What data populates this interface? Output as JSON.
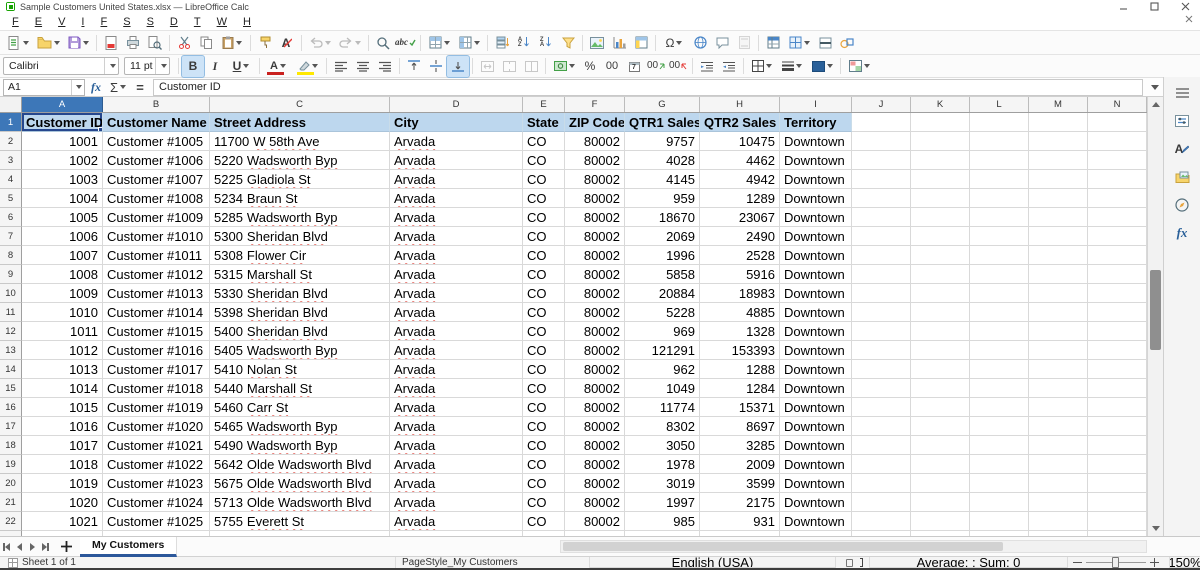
{
  "window": {
    "title": "Sample Customers United States.xlsx — LibreOffice Calc",
    "controls": [
      "minimize",
      "maximize",
      "close"
    ]
  },
  "menu": {
    "items": [
      "File",
      "Edit",
      "View",
      "Insert",
      "Format",
      "Styles",
      "Sheet",
      "Data",
      "Tools",
      "Window",
      "Help"
    ]
  },
  "toolbars": {
    "standard_icons": [
      "new",
      "open",
      "save",
      "export-as-pdf",
      "print",
      "print-preview",
      "cut",
      "copy",
      "paste",
      "clone-formatting",
      "clear-formatting",
      "undo",
      "redo",
      "find-and-replace",
      "spelling",
      "insert-rows",
      "insert-columns",
      "sort",
      "sort-ascending",
      "sort-descending",
      "autofilter",
      "insert-image",
      "insert-chart",
      "insert-pivot-table",
      "insert-special-character",
      "insert-hyperlink",
      "insert-comment",
      "headers-and-footers",
      "freeze-rows-and-columns",
      "show-grid-lines",
      "split-window",
      "show-draw-functions"
    ],
    "formatting": {
      "font_name": "Calibri",
      "font_size": "11 pt",
      "icons": [
        "bold",
        "italic",
        "underline",
        "font-color",
        "highlighting-color",
        "align-left",
        "align-center",
        "align-right",
        "align-top",
        "center-vertically",
        "align-bottom",
        "merge-and-center-cells",
        "merge-cells",
        "unmerge-cells",
        "format-as-currency",
        "format-as-percent",
        "format-as-number",
        "format-as-date",
        "add-decimal-place",
        "delete-decimal-place",
        "increase-indent",
        "decrease-indent",
        "borders",
        "border-style",
        "background-color",
        "conditional-formatting"
      ],
      "active": [
        "bold",
        "align-bottom"
      ]
    }
  },
  "glyphs": {
    "bold": "B",
    "italic": "I",
    "underline": "U",
    "letter_a": "A",
    "omega": "Ω",
    "sigma": "Σ",
    "fx": "fx",
    "equals": "=",
    "percent": "%",
    "zeros": "00",
    "abc": "abc",
    "a": "A",
    "z": "Z",
    "date": "7"
  },
  "formula_bar": {
    "cell_reference": "A1",
    "content": "Customer ID"
  },
  "grid": {
    "columns": [
      "A",
      "B",
      "C",
      "D",
      "E",
      "F",
      "G",
      "H",
      "I",
      "J",
      "K",
      "L",
      "M",
      "N"
    ],
    "selected_cell": "A1",
    "header_row": {
      "row": "1",
      "cells": [
        "Customer ID",
        "Customer Name",
        "Street Address",
        "City",
        "State",
        "ZIP Code",
        "QTR1 Sales",
        "QTR2 Sales",
        "Territory"
      ]
    },
    "rows": [
      [
        "2",
        "1001",
        "Customer #1005",
        "11700",
        "W 58th Ave",
        "Arvada",
        "CO",
        "80002",
        "9757",
        "10475",
        "Downtown"
      ],
      [
        "3",
        "1002",
        "Customer #1006",
        "5220",
        "Wadsworth Byp",
        "Arvada",
        "CO",
        "80002",
        "4028",
        "4462",
        "Downtown"
      ],
      [
        "4",
        "1003",
        "Customer #1007",
        "5225",
        "Gladiola St",
        "Arvada",
        "CO",
        "80002",
        "4145",
        "4942",
        "Downtown"
      ],
      [
        "5",
        "1004",
        "Customer #1008",
        "5234",
        "Braun St",
        "Arvada",
        "CO",
        "80002",
        "959",
        "1289",
        "Downtown"
      ],
      [
        "6",
        "1005",
        "Customer #1009",
        "5285",
        "Wadsworth Byp",
        "Arvada",
        "CO",
        "80002",
        "18670",
        "23067",
        "Downtown"
      ],
      [
        "7",
        "1006",
        "Customer #1010",
        "5300",
        "Sheridan Blvd",
        "Arvada",
        "CO",
        "80002",
        "2069",
        "2490",
        "Downtown"
      ],
      [
        "8",
        "1007",
        "Customer #1011",
        "5308",
        "Flower Cir",
        "Arvada",
        "CO",
        "80002",
        "1996",
        "2528",
        "Downtown"
      ],
      [
        "9",
        "1008",
        "Customer #1012",
        "5315",
        "Marshall St",
        "Arvada",
        "CO",
        "80002",
        "5858",
        "5916",
        "Downtown"
      ],
      [
        "10",
        "1009",
        "Customer #1013",
        "5330",
        "Sheridan Blvd",
        "Arvada",
        "CO",
        "80002",
        "20884",
        "18983",
        "Downtown"
      ],
      [
        "11",
        "1010",
        "Customer #1014",
        "5398",
        "Sheridan Blvd",
        "Arvada",
        "CO",
        "80002",
        "5228",
        "4885",
        "Downtown"
      ],
      [
        "12",
        "1011",
        "Customer #1015",
        "5400",
        "Sheridan Blvd",
        "Arvada",
        "CO",
        "80002",
        "969",
        "1328",
        "Downtown"
      ],
      [
        "13",
        "1012",
        "Customer #1016",
        "5405",
        "Wadsworth Byp",
        "Arvada",
        "CO",
        "80002",
        "121291",
        "153393",
        "Downtown"
      ],
      [
        "14",
        "1013",
        "Customer #1017",
        "5410",
        "Nolan St",
        "Arvada",
        "CO",
        "80002",
        "962",
        "1288",
        "Downtown"
      ],
      [
        "15",
        "1014",
        "Customer #1018",
        "5440",
        "Marshall St",
        "Arvada",
        "CO",
        "80002",
        "1049",
        "1284",
        "Downtown"
      ],
      [
        "16",
        "1015",
        "Customer #1019",
        "5460",
        "Carr St",
        "Arvada",
        "CO",
        "80002",
        "11774",
        "15371",
        "Downtown"
      ],
      [
        "17",
        "1016",
        "Customer #1020",
        "5465",
        "Wadsworth Byp",
        "Arvada",
        "CO",
        "80002",
        "8302",
        "8697",
        "Downtown"
      ],
      [
        "18",
        "1017",
        "Customer #1021",
        "5490",
        "Wadsworth Byp",
        "Arvada",
        "CO",
        "80002",
        "3050",
        "3285",
        "Downtown"
      ],
      [
        "19",
        "1018",
        "Customer #1022",
        "5642",
        "Olde Wadsworth Blvd",
        "Arvada",
        "CO",
        "80002",
        "1978",
        "2009",
        "Downtown"
      ],
      [
        "20",
        "1019",
        "Customer #1023",
        "5675",
        "Olde Wadsworth Blvd",
        "Arvada",
        "CO",
        "80002",
        "3019",
        "3599",
        "Downtown"
      ],
      [
        "21",
        "1020",
        "Customer #1024",
        "5713",
        "Olde Wadsworth Blvd",
        "Arvada",
        "CO",
        "80002",
        "1997",
        "2175",
        "Downtown"
      ],
      [
        "22",
        "1021",
        "Customer #1025",
        "5755",
        "Everett St",
        "Arvada",
        "CO",
        "80002",
        "985",
        "931",
        "Downtown"
      ]
    ]
  },
  "sidebar_icons": [
    "sidebar-settings",
    "properties",
    "styles",
    "gallery",
    "navigator",
    "functions"
  ],
  "sheet_tabs": {
    "active": "My Customers"
  },
  "status_bar": {
    "sheet": "Sheet 1 of 1",
    "page_style": "PageStyle_My Customers",
    "language": "English (USA)",
    "stats": "Average: ; Sum: 0",
    "zoom": "150%"
  },
  "colors": {
    "header_fill": "#BDD7EE",
    "selected_header": "#3D77B8",
    "selection_border": "#26478D",
    "grid_line": "#D9D9D9",
    "font_color_indicator": "#C9211E",
    "highlight_indicator": "#FFFF00",
    "background_color_indicator": "#2A6099",
    "app_icon_green": "#18A303",
    "active_tool_bg": "#CDE3F7"
  }
}
